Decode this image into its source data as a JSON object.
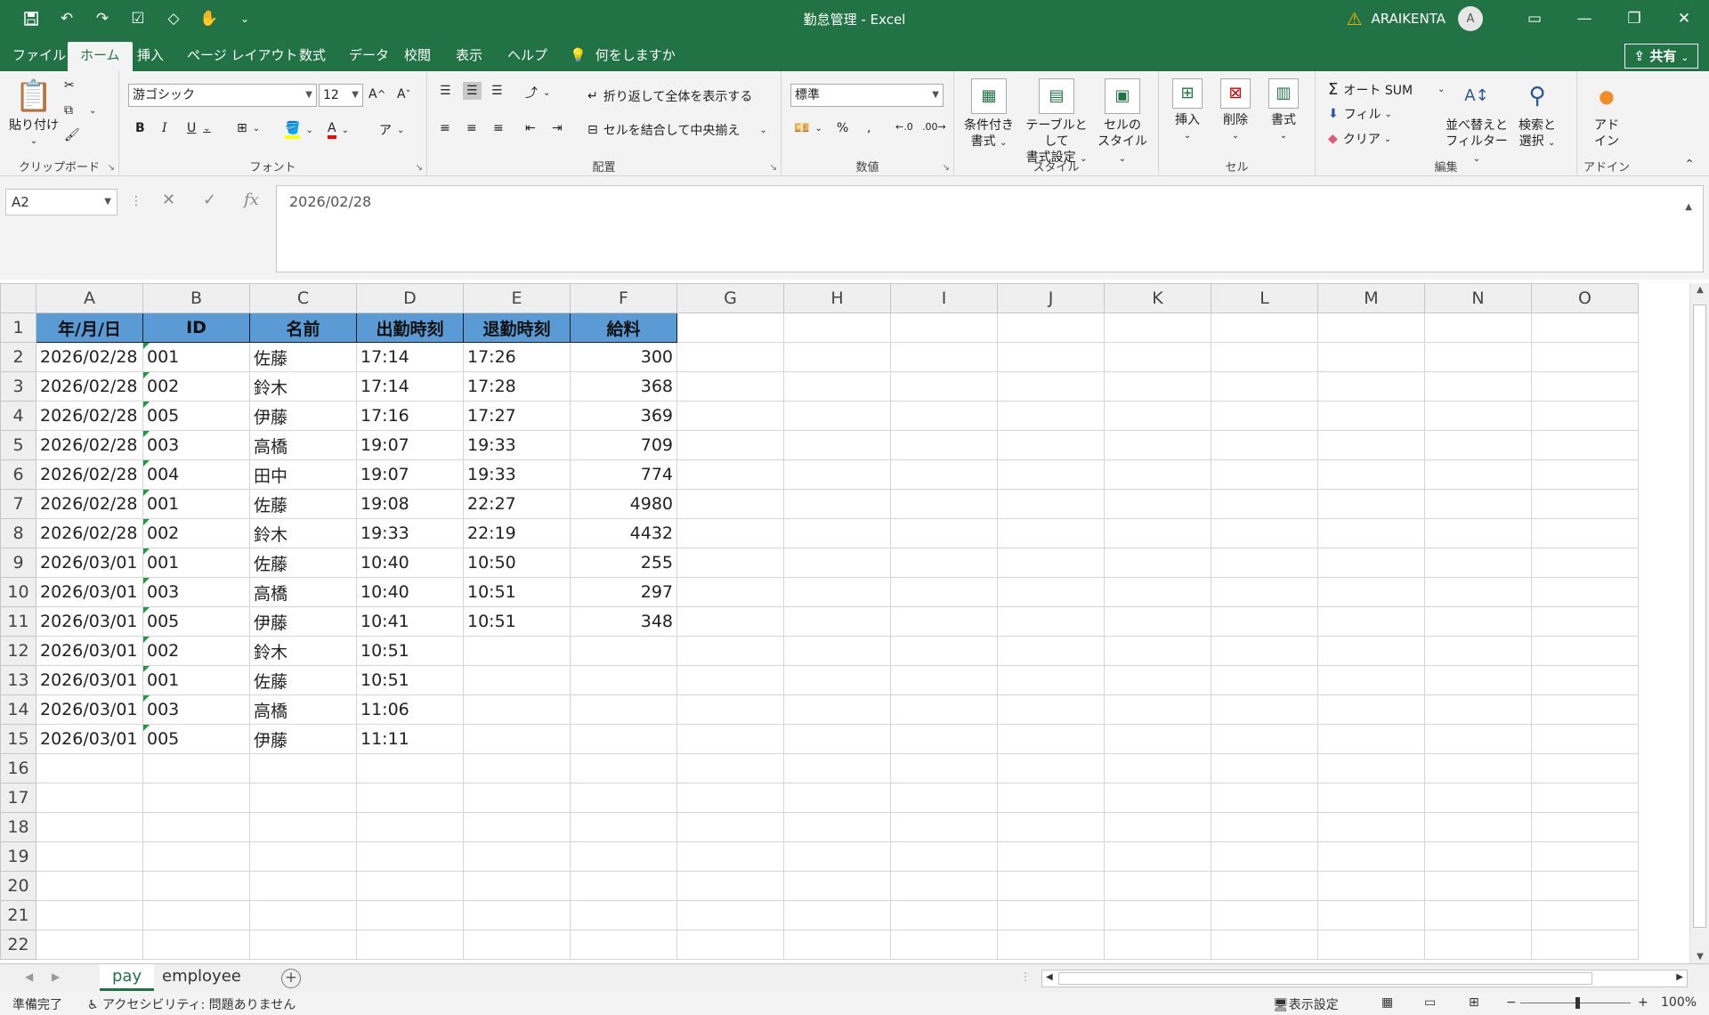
{
  "window": {
    "title": "勤怠管理  -  Excel",
    "user": "ARAIKENTA",
    "avatar_letter": "A"
  },
  "tabs": [
    "ファイル",
    "ホーム",
    "挿入",
    "ページ レイアウト",
    "数式",
    "データ",
    "校閲",
    "表示",
    "ヘルプ"
  ],
  "active_tab": "ホーム",
  "tell_me": "何をしますか",
  "share_label": "共有",
  "ribbon": {
    "clipboard": {
      "label": "クリップボード",
      "paste": "貼り付け"
    },
    "font": {
      "label": "フォント",
      "font_name": "游ゴシック",
      "font_size": "12"
    },
    "alignment": {
      "label": "配置",
      "wrap_text": "折り返して全体を表示する",
      "merge_center": "セルを結合して中央揃え"
    },
    "number": {
      "label": "数値",
      "format": "標準"
    },
    "styles": {
      "label": "スタイル",
      "conditional_line1": "条件付き",
      "conditional_line2": "書式",
      "table_line1": "テーブルとして",
      "table_line2": "書式設定",
      "cell_line1": "セルの",
      "cell_line2": "スタイル"
    },
    "cells": {
      "label": "セル",
      "insert": "挿入",
      "delete": "削除",
      "format": "書式"
    },
    "editing": {
      "label": "編集",
      "autosum": "オート SUM",
      "fill": "フィル",
      "clear": "クリア",
      "sort_line1": "並べ替えと",
      "sort_line2": "フィルター",
      "find_line1": "検索と",
      "find_line2": "選択"
    },
    "addin": {
      "label": "アドイン",
      "btn_line1": "アド",
      "btn_line2": "イン"
    }
  },
  "formula_bar": {
    "name_box": "A2",
    "content": "2026/02/28"
  },
  "grid": {
    "columns": [
      "A",
      "B",
      "C",
      "D",
      "E",
      "F",
      "G",
      "H",
      "I",
      "J",
      "K",
      "L",
      "M",
      "N",
      "O"
    ],
    "row_numbers": [
      "1",
      "2",
      "3",
      "4",
      "5",
      "6",
      "7",
      "8",
      "9",
      "10",
      "11",
      "12",
      "13",
      "14",
      "15",
      "16",
      "17",
      "18",
      "19",
      "20",
      "21",
      "22"
    ],
    "headers": [
      "年/月/日",
      "ID",
      "名前",
      "出勤時刻",
      "退勤時刻",
      "給料"
    ],
    "rows": [
      [
        "2026/02/28",
        "001",
        "佐藤",
        "17:14",
        "17:26",
        "300"
      ],
      [
        "2026/02/28",
        "002",
        "鈴木",
        "17:14",
        "17:28",
        "368"
      ],
      [
        "2026/02/28",
        "005",
        "伊藤",
        "17:16",
        "17:27",
        "369"
      ],
      [
        "2026/02/28",
        "003",
        "高橋",
        "19:07",
        "19:33",
        "709"
      ],
      [
        "2026/02/28",
        "004",
        "田中",
        "19:07",
        "19:33",
        "774"
      ],
      [
        "2026/02/28",
        "001",
        "佐藤",
        "19:08",
        "22:27",
        "4980"
      ],
      [
        "2026/02/28",
        "002",
        "鈴木",
        "19:33",
        "22:19",
        "4432"
      ],
      [
        "2026/03/01",
        "001",
        "佐藤",
        "10:40",
        "10:50",
        "255"
      ],
      [
        "2026/03/01",
        "003",
        "高橋",
        "10:40",
        "10:51",
        "297"
      ],
      [
        "2026/03/01",
        "005",
        "伊藤",
        "10:41",
        "10:51",
        "348"
      ],
      [
        "2026/03/01",
        "002",
        "鈴木",
        "10:51",
        "",
        ""
      ],
      [
        "2026/03/01",
        "001",
        "佐藤",
        "10:51",
        "",
        ""
      ],
      [
        "2026/03/01",
        "003",
        "高橋",
        "11:06",
        "",
        ""
      ],
      [
        "2026/03/01",
        "005",
        "伊藤",
        "11:11",
        "",
        ""
      ]
    ]
  },
  "sheets": [
    "pay",
    "employee"
  ],
  "active_sheet": "pay",
  "status": {
    "ready": "準備完了",
    "accessibility": "アクセシビリティ: 問題ありません",
    "display_settings": "表示設定",
    "zoom": "100%"
  },
  "colors": {
    "accent": "#217346",
    "header_fill": "#5b9bd5",
    "text_flag": "#1e9b3c"
  }
}
